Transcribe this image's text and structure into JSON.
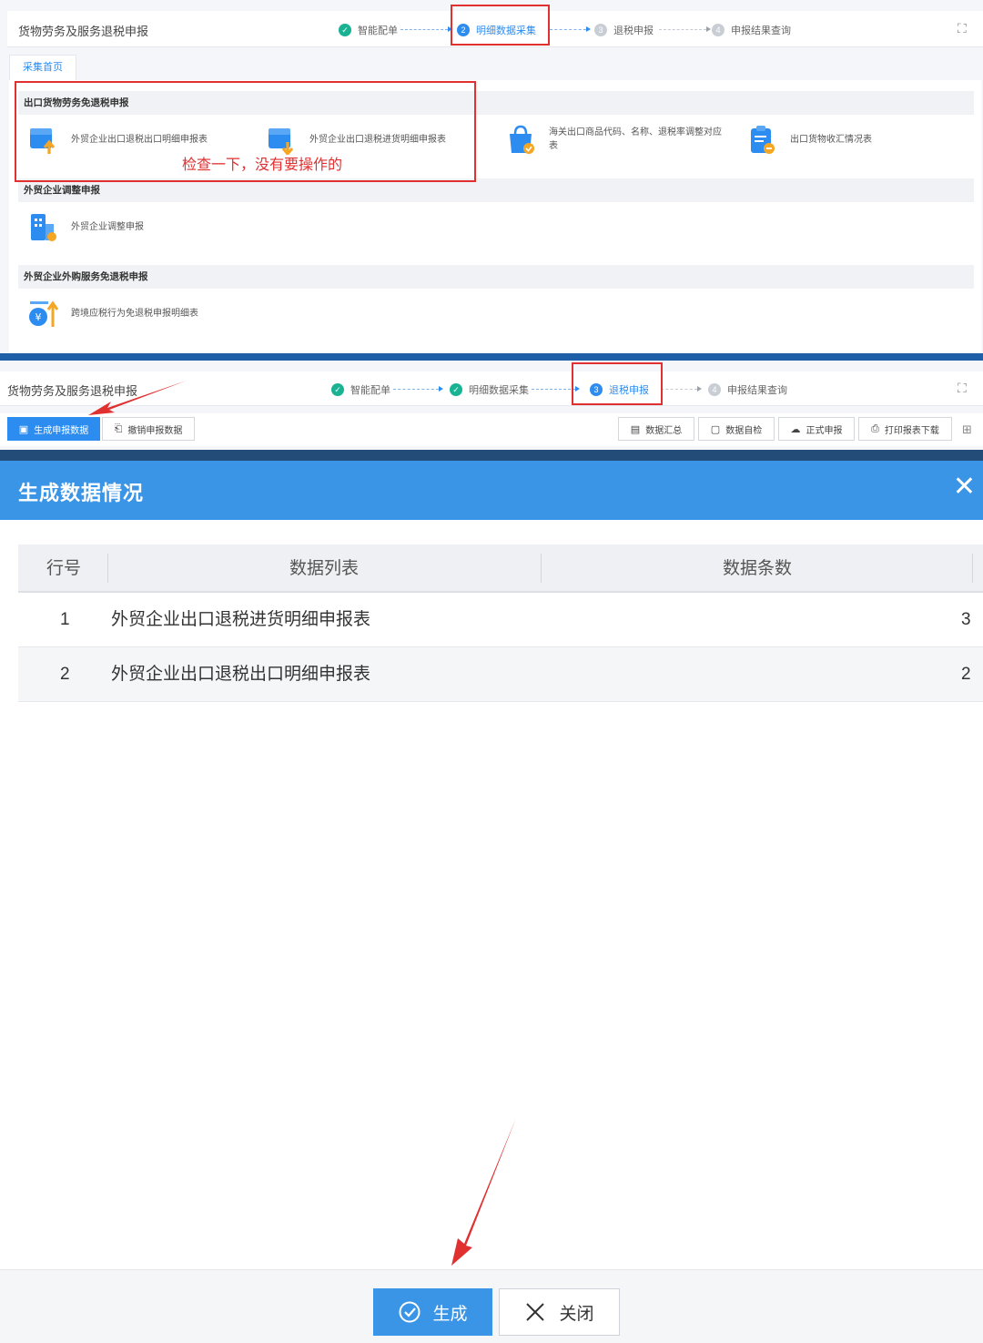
{
  "screen1": {
    "app_title": "货物劳务及服务退税申报",
    "steps": [
      {
        "num": "",
        "label": "智能配单",
        "state": "done"
      },
      {
        "num": "2",
        "label": "明细数据采集",
        "state": "active"
      },
      {
        "num": "3",
        "label": "退税申报",
        "state": "pending"
      },
      {
        "num": "4",
        "label": "申报结果查询",
        "state": "pending"
      }
    ],
    "tab_home": "采集首页",
    "sections": [
      {
        "title": "出口货物劳务免退税申报",
        "items": [
          "外贸企业出口退税出口明细申报表",
          "外贸企业出口退税进货明细申报表",
          "海关出口商品代码、名称、退税率调整对应表",
          "出口货物收汇情况表"
        ]
      },
      {
        "title": "外贸企业调整申报",
        "items": [
          "外贸企业调整申报"
        ]
      },
      {
        "title": "外贸企业外购服务免退税申报",
        "items": [
          "跨境应税行为免退税申报明细表"
        ]
      }
    ],
    "annotation": "检查一下，没有要操作的"
  },
  "screen2": {
    "app_title": "货物劳务及服务退税申报",
    "steps": [
      {
        "num": "",
        "label": "智能配单",
        "state": "done"
      },
      {
        "num": "",
        "label": "明细数据采集",
        "state": "done"
      },
      {
        "num": "3",
        "label": "退税申报",
        "state": "active"
      },
      {
        "num": "4",
        "label": "申报结果查询",
        "state": "pending"
      }
    ],
    "toolbar_left": [
      "生成申报数据",
      "撤销申报数据"
    ],
    "toolbar_right": [
      "数据汇总",
      "数据自检",
      "正式申报",
      "打印报表下载"
    ]
  },
  "modal": {
    "title": "生成数据情况",
    "columns": [
      "行号",
      "数据列表",
      "数据条数"
    ],
    "rows": [
      {
        "no": "1",
        "name": "外贸企业出口退税进货明细申报表",
        "count": "3"
      },
      {
        "no": "2",
        "name": "外贸企业出口退税出口明细申报表",
        "count": "2"
      }
    ],
    "generate_label": "生成",
    "close_label": "关闭"
  },
  "colors": {
    "primary": "#2d8cf0",
    "modal_header": "#3b95e6",
    "done_green": "#19b394",
    "annotation_red": "#e03030"
  }
}
